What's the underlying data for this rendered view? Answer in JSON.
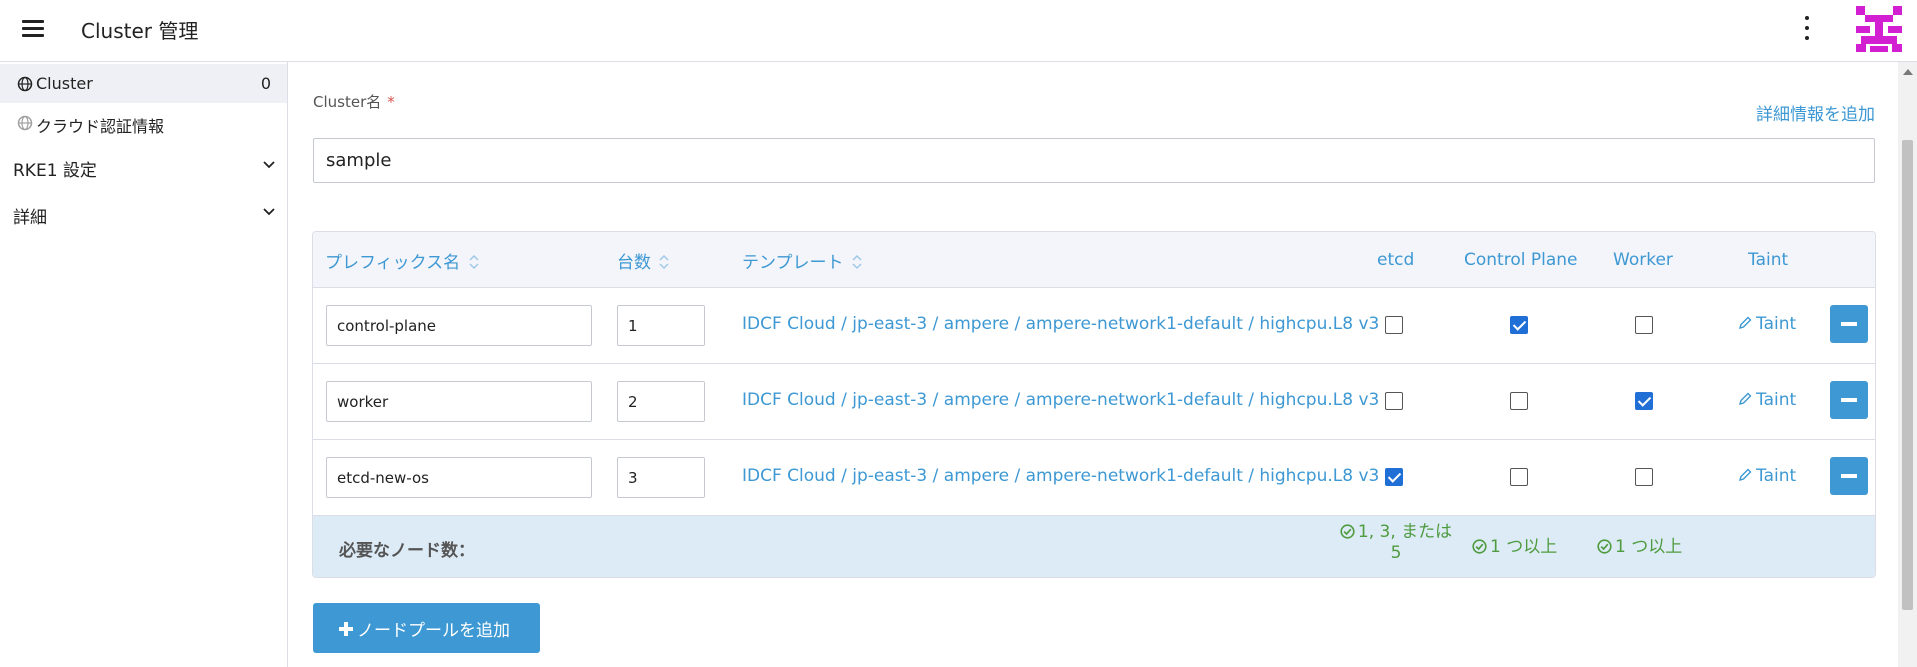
{
  "header": {
    "title": "Cluster 管理",
    "menu_icon": "hamburger-menu-icon",
    "more_icon": "vertical-ellipsis-icon",
    "avatar_color": "#d21fd2"
  },
  "sidebar": {
    "items": [
      {
        "label": "Cluster",
        "count": "0",
        "icon": "globe-icon",
        "active": true
      },
      {
        "label": "クラウド認証情報",
        "icon": "globe-icon",
        "active": false
      }
    ],
    "groups": [
      {
        "label": "RKE1 設定",
        "icon": "chevron-down-icon"
      },
      {
        "label": "詳細",
        "icon": "chevron-down-icon"
      }
    ]
  },
  "form": {
    "cluster_name_label": "Cluster名",
    "required_mark": "*",
    "add_detail_link": "詳細情報を追加",
    "cluster_name_value": "sample"
  },
  "node_pools": {
    "headers": {
      "prefix": "プレフィックス名",
      "count": "台数",
      "template": "テンプレート",
      "etcd": "etcd",
      "control_plane": "Control Plane",
      "worker": "Worker",
      "taint": "Taint"
    },
    "rows": [
      {
        "prefix": "control-plane",
        "count": "1",
        "template": "IDCF Cloud / jp-east-3 / ampere / ampere-network1-default / highcpu.L8 v3",
        "etcd": false,
        "control_plane": true,
        "worker": false,
        "taint": "Taint"
      },
      {
        "prefix": "worker",
        "count": "2",
        "template": "IDCF Cloud / jp-east-3 / ampere / ampere-network1-default / highcpu.L8 v3",
        "etcd": false,
        "control_plane": false,
        "worker": true,
        "taint": "Taint"
      },
      {
        "prefix": "etcd-new-os",
        "count": "3",
        "template": "IDCF Cloud / jp-east-3 / ampere / ampere-network1-default / highcpu.L8 v3",
        "etcd": true,
        "control_plane": false,
        "worker": false,
        "taint": "Taint"
      }
    ],
    "footer": {
      "required_label": "必要なノード数：",
      "etcd_req_line1": "1, 3, または",
      "etcd_req_line2": "5",
      "control_plane_req": "1 つ以上",
      "worker_req": "1 つ以上"
    },
    "add_button": "ノードプールを追加"
  },
  "colors": {
    "accent": "#3d98d3",
    "checkbox_checked": "#1f6fd6",
    "success": "#4f9b3f",
    "footer_bg": "#dcebf6"
  }
}
